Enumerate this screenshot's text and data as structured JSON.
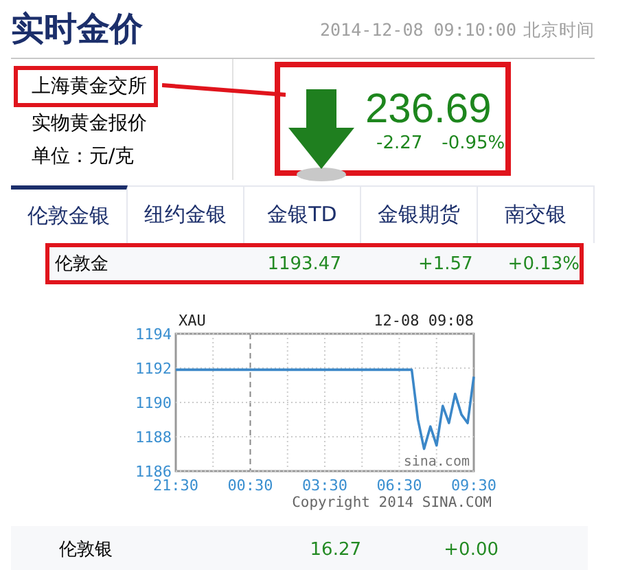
{
  "header": {
    "title": "实时金价",
    "timestamp": "2014-12-08 09:10:00",
    "timezone": "北京时间"
  },
  "quote": {
    "exchange": "上海黄金交所",
    "exchange_highlighted": true,
    "description": "实物黄金报价",
    "unit": "单位：元/克",
    "falling": true,
    "price": "236.69",
    "change": "-2.27",
    "change_percent": "-0.95%",
    "highlighted": true
  },
  "tabs": [
    {
      "label": "伦敦金银",
      "selected": true
    },
    {
      "label": "纽约金银",
      "selected": false
    },
    {
      "label": "金银TD",
      "selected": false
    },
    {
      "label": "金银期货",
      "selected": false
    },
    {
      "label": "南交银",
      "selected": false
    }
  ],
  "featured_row": {
    "name": "伦敦金",
    "price": "1193.47",
    "change": "+1.57",
    "change_percent": "+0.13%",
    "highlighted": true
  },
  "chart": {
    "chart_data": {
      "type": "line",
      "title": "XAU",
      "categories": [
        "21:30",
        null,
        null,
        null,
        null,
        null,
        null,
        null,
        null,
        null,
        null,
        null,
        "00:30",
        null,
        null,
        null,
        null,
        null,
        null,
        null,
        null,
        null,
        null,
        null,
        "03:30",
        null,
        null,
        null,
        null,
        null,
        null,
        null,
        null,
        null,
        null,
        null,
        "06:30",
        null,
        null,
        null,
        null,
        null,
        null,
        null,
        null,
        null,
        null,
        null,
        "09:30"
      ],
      "series": [
        {
          "color": "#3b87c8",
          "values": [
            1191.9,
            1191.9,
            1191.9,
            1191.9,
            1191.9,
            1191.9,
            1191.9,
            1191.9,
            1191.9,
            1191.9,
            1191.9,
            1191.9,
            1191.9,
            1191.9,
            1191.9,
            1191.9,
            1191.9,
            1191.9,
            1191.9,
            1191.9,
            1191.9,
            1191.9,
            1191.9,
            1191.9,
            1191.9,
            1191.9,
            1191.9,
            1191.9,
            1191.9,
            1191.9,
            1191.9,
            1191.9,
            1191.9,
            1191.9,
            1191.9,
            1191.9,
            1191.9,
            1191.9,
            1191.9,
            1189.0,
            1187.3,
            1188.6,
            1187.5,
            1189.8,
            1188.8,
            1190.5,
            1189.3,
            1188.8,
            1191.5
          ]
        }
      ],
      "ylim": [
        1186,
        1194
      ],
      "grid": true,
      "yticks": [
        1186,
        1188,
        1190,
        1192,
        1194
      ],
      "annotations": [
        "12-08 09:08",
        "sina.com"
      ]
    },
    "copyright": "Copyright 2014 SINA.COM"
  },
  "rows": [
    {
      "name": "伦敦银",
      "price": "16.27",
      "change": "+0.00",
      "highlighted": false
    }
  ]
}
